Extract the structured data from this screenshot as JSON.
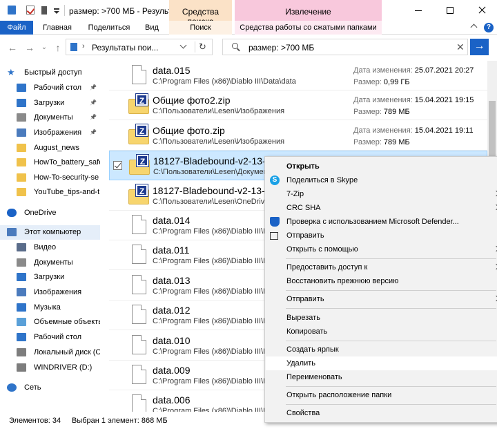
{
  "window": {
    "title": "размер: >700 МБ - Результ...",
    "context_tab_search": "Средства поиска",
    "context_tab_extract": "Извлечение"
  },
  "ribbon": {
    "tabs": [
      {
        "label": "Файл"
      },
      {
        "label": "Главная"
      },
      {
        "label": "Поделиться"
      },
      {
        "label": "Вид"
      },
      {
        "label": "Поиск"
      },
      {
        "label": "Средства работы со сжатыми папками"
      }
    ],
    "help": "?"
  },
  "nav": {
    "back": "←",
    "forward": "→",
    "recent": "⌄",
    "up": "↑",
    "address": "Результаты пои...",
    "refresh": "↻",
    "search_text": "размер: >700 МБ",
    "search_clear": "✕",
    "go": "→"
  },
  "sidebar": {
    "items": [
      {
        "label": "Быстрый доступ",
        "icon": "star-icon",
        "pinned": false
      },
      {
        "label": "Рабочий стол",
        "icon": "desktop-icon",
        "pinned": true
      },
      {
        "label": "Загрузки",
        "icon": "download-icon",
        "pinned": true
      },
      {
        "label": "Документы",
        "icon": "documents-icon",
        "pinned": true
      },
      {
        "label": "Изображения",
        "icon": "pictures-icon",
        "pinned": true
      },
      {
        "label": "August_news",
        "icon": "folder-icon",
        "pinned": false
      },
      {
        "label": "HowTo_battery_safe",
        "icon": "folder-icon",
        "pinned": false
      },
      {
        "label": "How-To-security-se",
        "icon": "folder-icon",
        "pinned": false
      },
      {
        "label": "YouTube_tips-and-t",
        "icon": "folder-icon",
        "pinned": false
      },
      {
        "label": "OneDrive",
        "icon": "cloud-icon",
        "pinned": false
      },
      {
        "label": "Этот компьютер",
        "icon": "computer-icon",
        "pinned": false
      },
      {
        "label": "Видео",
        "icon": "video-icon",
        "pinned": false
      },
      {
        "label": "Документы",
        "icon": "documents-icon",
        "pinned": false
      },
      {
        "label": "Загрузки",
        "icon": "download-icon",
        "pinned": false
      },
      {
        "label": "Изображения",
        "icon": "pictures-icon",
        "pinned": false
      },
      {
        "label": "Музыка",
        "icon": "music-icon",
        "pinned": false
      },
      {
        "label": "Объемные объекты",
        "icon": "3d-objects-icon",
        "pinned": false
      },
      {
        "label": "Рабочий стол",
        "icon": "desktop-icon",
        "pinned": false
      },
      {
        "label": "Локальный диск (C",
        "icon": "drive-icon",
        "pinned": false
      },
      {
        "label": "WINDRIVER (D:)",
        "icon": "drive-icon",
        "pinned": false
      },
      {
        "label": "Сеть",
        "icon": "network-icon",
        "pinned": false
      }
    ],
    "pin_glyph": "📌"
  },
  "files": [
    {
      "name": "data.015",
      "path": "C:\\Program Files (x86)\\Diablo III\\Data\\data",
      "type": "doc",
      "modified_label": "Дата изменения:",
      "modified": "25.07.2021 20:27",
      "size_label": "Размер:",
      "size": "0,99 ГБ"
    },
    {
      "name": "Общие фото2.zip",
      "path": "C:\\Пользователи\\Lesen\\Изображения",
      "type": "zip",
      "modified_label": "Дата изменения:",
      "modified": "15.04.2021 19:15",
      "size_label": "Размер:",
      "size": "789 МБ"
    },
    {
      "name": "Общие фото.zip",
      "path": "C:\\Пользователи\\Lesen\\Изображения",
      "type": "zip",
      "modified_label": "Дата изменения:",
      "modified": "15.04.2021 19:11",
      "size_label": "Размер:",
      "size": "789 МБ"
    },
    {
      "name": "18127-Bladebound-v2-13-0",
      "path": "C:\\Пользователи\\Lesen\\Докумен",
      "type": "zip",
      "selected": true
    },
    {
      "name": "18127-Bladebound-v2-13-0",
      "path": "C:\\Пользователи\\Lesen\\OneDriv",
      "type": "zip"
    },
    {
      "name": "data.014",
      "path": "C:\\Program Files (x86)\\Diablo III\\D",
      "type": "doc"
    },
    {
      "name": "data.011",
      "path": "C:\\Program Files (x86)\\Diablo III\\D",
      "type": "doc"
    },
    {
      "name": "data.013",
      "path": "C:\\Program Files (x86)\\Diablo III\\D",
      "type": "doc"
    },
    {
      "name": "data.012",
      "path": "C:\\Program Files (x86)\\Diablo III\\D",
      "type": "doc"
    },
    {
      "name": "data.010",
      "path": "C:\\Program Files (x86)\\Diablo III\\D",
      "type": "doc"
    },
    {
      "name": "data.009",
      "path": "C:\\Program Files (x86)\\Diablo III\\D",
      "type": "doc"
    },
    {
      "name": "data.006",
      "path": "C:\\Program Files (x86)\\Diablo III\\D",
      "type": "doc"
    }
  ],
  "status": {
    "count": "Элементов: 34",
    "selected": "Выбран 1 элемент: 868 МБ"
  },
  "context_menu": {
    "items": [
      {
        "label": "Открыть",
        "bold": true
      },
      {
        "label": "Поделиться в Skype",
        "icon": "skype-icon"
      },
      {
        "label": "7-Zip",
        "submenu": true
      },
      {
        "label": "CRC SHA",
        "submenu": true
      },
      {
        "label": "Проверка с использованием Microsoft Defender...",
        "icon": "defender-icon"
      },
      {
        "label": "Отправить",
        "icon": "share-icon"
      },
      {
        "label": "Открыть с помощью",
        "submenu": true
      },
      {
        "separator": true
      },
      {
        "label": "Предоставить доступ к",
        "submenu": true
      },
      {
        "label": "Восстановить прежнюю версию"
      },
      {
        "separator": true
      },
      {
        "label": "Отправить",
        "submenu": true
      },
      {
        "separator": true
      },
      {
        "label": "Вырезать"
      },
      {
        "label": "Копировать"
      },
      {
        "separator": true
      },
      {
        "label": "Создать ярлык"
      },
      {
        "label": "Удалить",
        "highlighted": true
      },
      {
        "label": "Переименовать"
      },
      {
        "separator": true
      },
      {
        "label": "Открыть расположение папки"
      },
      {
        "separator": true
      },
      {
        "label": "Свойства"
      }
    ]
  },
  "colors": {
    "accent": "#1a62c6",
    "selection": "#cce8ff",
    "search_tools_tab": "#fbe2c7",
    "extract_tab": "#f8c8dc"
  }
}
